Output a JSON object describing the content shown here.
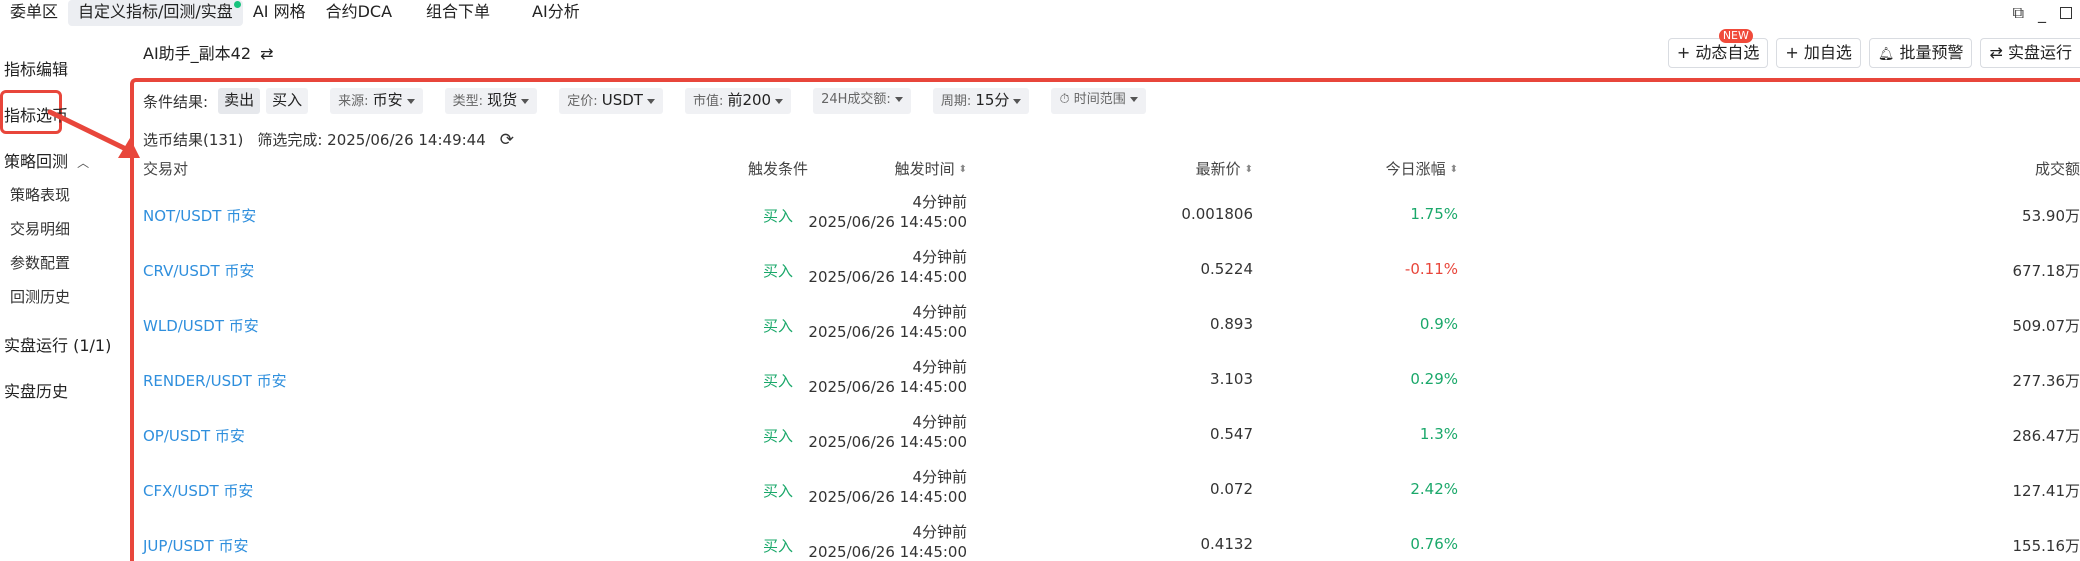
{
  "nav": {
    "tabs": [
      {
        "label": "委单区",
        "active": false
      },
      {
        "label": "自定义指标/回测/实盘",
        "active": true
      },
      {
        "label": "AI 网格",
        "active": false
      },
      {
        "label": "合约DCA",
        "active": false
      },
      {
        "label": "组合下单",
        "active": false
      },
      {
        "label": "AI分析",
        "active": false
      }
    ]
  },
  "sidebar": {
    "indicator_edit": "指标编辑",
    "indicator_select": "指标选币",
    "backtest": "策略回测",
    "backtest_sub": [
      "策略表现",
      "交易明细",
      "参数配置",
      "回测历史"
    ],
    "live_run": "实盘运行 (1/1)",
    "live_history": "实盘历史"
  },
  "header": {
    "title": "AI助手_副本42",
    "actions": {
      "dynamic_watch": "动态自选",
      "new_badge": "NEW",
      "add_watch": "加自选",
      "batch_alert": "批量预警",
      "live_run": "实盘运行"
    }
  },
  "filters": {
    "condition_label": "条件结果:",
    "sell": "卖出",
    "buy": "买入",
    "source_label": "来源:",
    "source_value": "币安",
    "type_label": "类型:",
    "type_value": "现货",
    "quote_label": "定价:",
    "quote_value": "USDT",
    "mcap_label": "市值:",
    "mcap_value": "前200",
    "vol24_label": "24H成交额:",
    "period_label": "周期:",
    "period_value": "15分",
    "time_range": "时间范围"
  },
  "result": {
    "count_text": "选币结果(131)",
    "done_text": "筛选完成: 2025/06/26 14:49:44"
  },
  "table": {
    "columns": {
      "pair": "交易对",
      "condition": "触发条件",
      "time": "触发时间",
      "price": "最新价",
      "change": "今日涨幅",
      "volume": "成交额"
    },
    "rows": [
      {
        "pair": "NOT/USDT 币安",
        "condition": "买入",
        "ago": "4分钟前",
        "time": "2025/06/26 14:45:00",
        "price": "0.001806",
        "change": "1.75%",
        "dir": "pos",
        "volume": "53.90万"
      },
      {
        "pair": "CRV/USDT 币安",
        "condition": "买入",
        "ago": "4分钟前",
        "time": "2025/06/26 14:45:00",
        "price": "0.5224",
        "change": "-0.11%",
        "dir": "neg",
        "volume": "677.18万"
      },
      {
        "pair": "WLD/USDT 币安",
        "condition": "买入",
        "ago": "4分钟前",
        "time": "2025/06/26 14:45:00",
        "price": "0.893",
        "change": "0.9%",
        "dir": "pos",
        "volume": "509.07万"
      },
      {
        "pair": "RENDER/USDT 币安",
        "condition": "买入",
        "ago": "4分钟前",
        "time": "2025/06/26 14:45:00",
        "price": "3.103",
        "change": "0.29%",
        "dir": "pos",
        "volume": "277.36万"
      },
      {
        "pair": "OP/USDT 币安",
        "condition": "买入",
        "ago": "4分钟前",
        "time": "2025/06/26 14:45:00",
        "price": "0.547",
        "change": "1.3%",
        "dir": "pos",
        "volume": "286.47万"
      },
      {
        "pair": "CFX/USDT 币安",
        "condition": "买入",
        "ago": "4分钟前",
        "time": "2025/06/26 14:45:00",
        "price": "0.072",
        "change": "2.42%",
        "dir": "pos",
        "volume": "127.41万"
      },
      {
        "pair": "JUP/USDT 币安",
        "condition": "买入",
        "ago": "4分钟前",
        "time": "2025/06/26 14:45:00",
        "price": "0.4132",
        "change": "0.76%",
        "dir": "pos",
        "volume": "155.16万"
      }
    ]
  },
  "colors": {
    "accent_red": "#e8463b",
    "link_blue": "#2f8fdd",
    "up_green": "#1aa86a",
    "down_red": "#e8463b"
  }
}
